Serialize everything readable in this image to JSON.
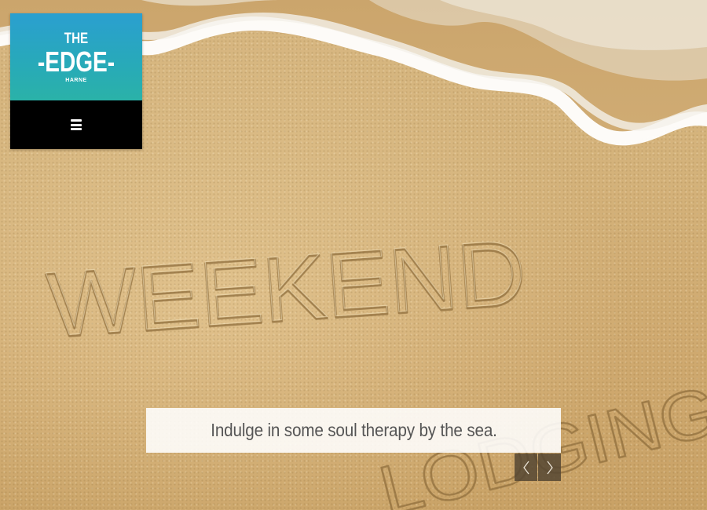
{
  "logo": {
    "line1": "THE",
    "line2": "-EDGE-",
    "line3": "HARNE"
  },
  "menu": {
    "icon": "hamburger-menu-icon"
  },
  "slider": {
    "caption": "Indulge in some soul therapy by the sea.",
    "prev_icon": "chevron-left-icon",
    "next_icon": "chevron-right-icon"
  },
  "hero": {
    "sand_writing_line1": "WEEKEND",
    "sand_writing_line2": "LODGING"
  },
  "colors": {
    "logo_gradient_top": "#2a9fd0",
    "logo_gradient_bottom": "#2ab2a8",
    "menu_bar": "#000000",
    "sand": "#d4b27a",
    "caption_bg": "#ffffff",
    "caption_text": "#555555",
    "nav_button": "#554632"
  }
}
